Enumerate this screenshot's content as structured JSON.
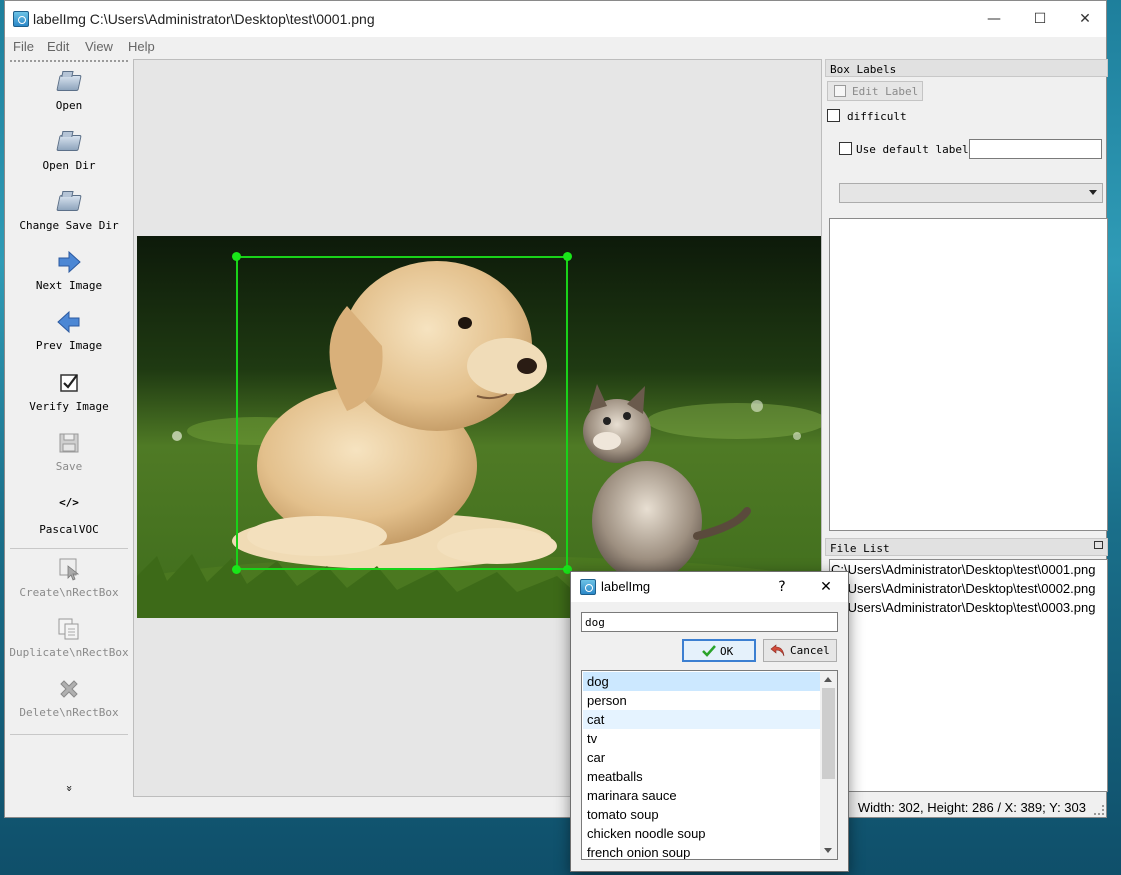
{
  "window": {
    "title": "labelImg C:\\Users\\Administrator\\Desktop\\test\\0001.png",
    "minimize": "—",
    "maximize": "☐",
    "close": "✕"
  },
  "menu": [
    "File",
    "Edit",
    "View",
    "Help"
  ],
  "toolbar": {
    "open": "Open",
    "open_dir": "Open Dir",
    "change_save_dir": "Change Save Dir",
    "next_image": "Next Image",
    "prev_image": "Prev Image",
    "verify_image": "Verify Image",
    "save": "Save",
    "format_icon": "</>",
    "format": "PascalVOC",
    "create_box": "Create\\nRectBox",
    "duplicate_box": "Duplicate\\nRectBox",
    "delete_box": "Delete\\nRectBox",
    "more": "»"
  },
  "box_labels": {
    "title": "Box Labels",
    "edit_label": "Edit Label",
    "difficult": "difficult",
    "use_default_label": "Use default label",
    "default_label_value": ""
  },
  "file_list": {
    "title": "File List",
    "files": [
      "C:\\Users\\Administrator\\Desktop\\test\\0001.png",
      "C:\\Users\\Administrator\\Desktop\\test\\0002.png",
      "C:\\Users\\Administrator\\Desktop\\test\\0003.png"
    ]
  },
  "status": {
    "text": "Width: 302, Height: 286 / X: 389; Y: 303"
  },
  "dialog": {
    "title": "labelImg",
    "help": "?",
    "close": "✕",
    "input_value": "dog",
    "ok": "OK",
    "cancel": "Cancel",
    "suggestions": [
      "dog",
      "person",
      "cat",
      "tv",
      "car",
      "meatballs",
      "marinara sauce",
      "tomato soup",
      "chicken noodle soup",
      "french onion soup"
    ]
  },
  "colors": {
    "bbox": "#19d219",
    "selection": "#cce8ff",
    "ok_border": "#3c7fd1"
  }
}
